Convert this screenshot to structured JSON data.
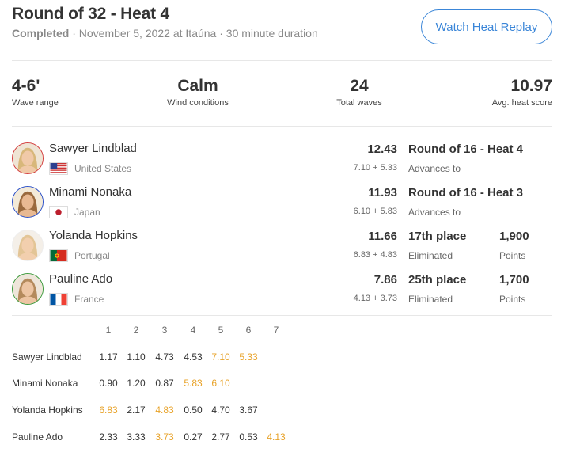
{
  "header": {
    "title": "Round of 32 - Heat 4",
    "status": "Completed",
    "details": "· November 5, 2022 at Itaúna · 30 minute duration",
    "replay_label": "Watch Heat Replay"
  },
  "stats": [
    {
      "value": "4-6'",
      "label": "Wave range"
    },
    {
      "value": "Calm",
      "label": "Wind conditions"
    },
    {
      "value": "24",
      "label": "Total waves"
    },
    {
      "value": "10.97",
      "label": "Avg. heat score"
    }
  ],
  "athletes": [
    {
      "name": "Sawyer Lindblad",
      "country": "United States",
      "flag": "us-flag",
      "total": "12.43",
      "breakdown": "7.10 + 5.33",
      "result": "Round of 16 - Heat 4",
      "result_sub": "Advances to",
      "points": "",
      "points_sub": "",
      "ring_color": "#d23a3a"
    },
    {
      "name": "Minami Nonaka",
      "country": "Japan",
      "flag": "jp-flag",
      "total": "11.93",
      "breakdown": "6.10 + 5.83",
      "result": "Round of 16 - Heat 3",
      "result_sub": "Advances to",
      "points": "",
      "points_sub": "",
      "ring_color": "#2b50c8"
    },
    {
      "name": "Yolanda Hopkins",
      "country": "Portugal",
      "flag": "pt-flag",
      "total": "11.66",
      "breakdown": "6.83 + 4.83",
      "result": "17th place",
      "result_sub": "Eliminated",
      "points": "1,900",
      "points_sub": "Points",
      "ring_color": "#eeeeee"
    },
    {
      "name": "Pauline Ado",
      "country": "France",
      "flag": "fr-flag",
      "total": "7.86",
      "breakdown": "4.13 + 3.73",
      "result": "25th place",
      "result_sub": "Eliminated",
      "points": "1,700",
      "points_sub": "Points",
      "ring_color": "#3c9a3c"
    }
  ],
  "wave_table": {
    "columns": [
      "1",
      "2",
      "3",
      "4",
      "5",
      "6",
      "7"
    ],
    "rows": [
      {
        "name": "Sawyer Lindblad",
        "waves": [
          "1.17",
          "1.10",
          "4.73",
          "4.53",
          "7.10",
          "5.33",
          ""
        ],
        "highlight": [
          false,
          false,
          false,
          false,
          true,
          true,
          false
        ]
      },
      {
        "name": "Minami Nonaka",
        "waves": [
          "0.90",
          "1.20",
          "0.87",
          "5.83",
          "6.10",
          "",
          ""
        ],
        "highlight": [
          false,
          false,
          false,
          true,
          true,
          false,
          false
        ]
      },
      {
        "name": "Yolanda Hopkins",
        "waves": [
          "6.83",
          "2.17",
          "4.83",
          "0.50",
          "4.70",
          "3.67",
          ""
        ],
        "highlight": [
          true,
          false,
          true,
          false,
          false,
          false,
          false
        ]
      },
      {
        "name": "Pauline Ado",
        "waves": [
          "2.33",
          "3.33",
          "3.73",
          "0.27",
          "2.77",
          "0.53",
          "4.13"
        ],
        "highlight": [
          false,
          false,
          true,
          false,
          false,
          false,
          true
        ]
      }
    ]
  },
  "colors": {
    "accent": "#3b86d8",
    "highlight": "#e8a32a",
    "muted": "#888888"
  }
}
